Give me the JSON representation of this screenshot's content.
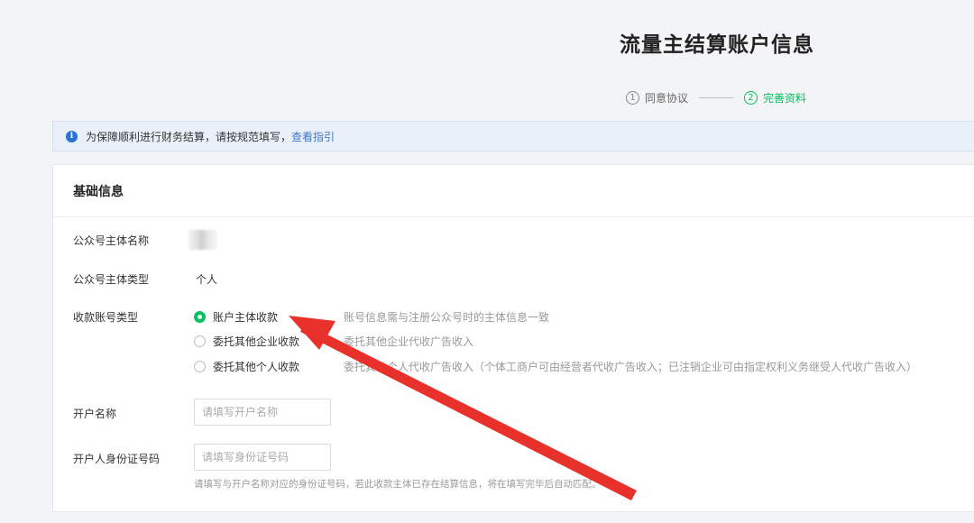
{
  "header": {
    "title": "流量主结算账户信息",
    "steps": [
      {
        "num": "1",
        "label": "同意协议",
        "state": "inactive"
      },
      {
        "num": "2",
        "label": "完善资料",
        "state": "active"
      }
    ]
  },
  "notice": {
    "text": "为保障顺利进行财务结算，请按规范填写，",
    "link": "查看指引",
    "icon": "info-icon"
  },
  "form": {
    "section_title": "基础信息",
    "subject_name_label": "公众号主体名称",
    "subject_type_label": "公众号主体类型",
    "subject_type_value": "个人",
    "account_type_label": "收款账号类型",
    "account_options": [
      {
        "label": "账户主体收款",
        "desc": "账号信息需与注册公众号时的主体信息一致",
        "checked": true
      },
      {
        "label": "委托其他企业收款",
        "desc": "委托其他企业代收广告收入",
        "checked": false
      },
      {
        "label": "委托其他个人收款",
        "desc": "委托其他个人代收广告收入（个体工商户可由经营者代收广告收入；已注销企业可由指定权利义务继受人代收广告收入）",
        "checked": false
      }
    ],
    "account_name_label": "开户名称",
    "account_name_placeholder": "请填写开户名称",
    "id_label": "开户人身份证号码",
    "id_placeholder": "请填写身份证号码",
    "id_hint": "请填写与开户名称对应的身份证号码，若此收款主体已存在结算信息，将在填写完毕后自动匹配。"
  },
  "colors": {
    "accent": "#07c160",
    "link": "#4377c9",
    "annotation_arrow": "#e8312a"
  }
}
